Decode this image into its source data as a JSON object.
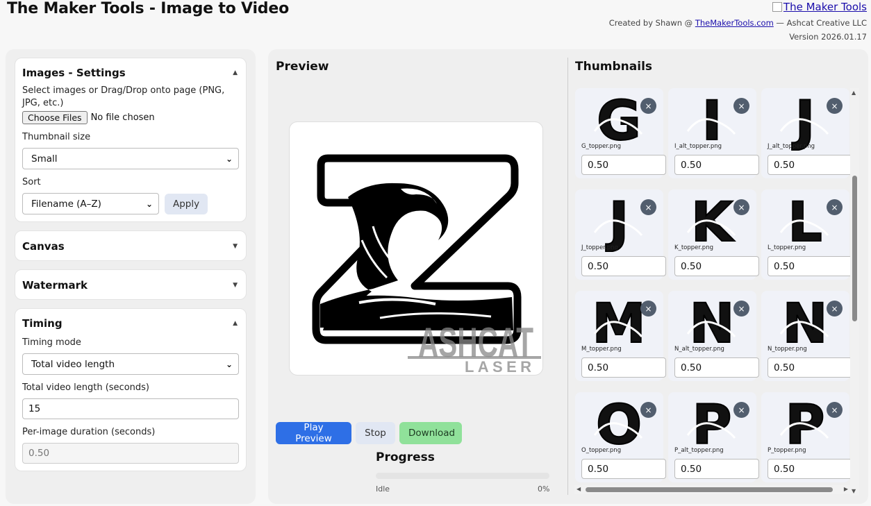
{
  "header": {
    "title": "The Maker Tools - Image to Video",
    "logo_alt": "The Maker Tools",
    "credit_prefix": "Created by Shawn @ ",
    "credit_link": "TheMakerTools.com",
    "credit_suffix": " — Ashcat Creative LLC",
    "version": "Version 2026.01.17"
  },
  "images_settings": {
    "title": "Images - Settings",
    "select_hint": "Select images or Drag/Drop onto page (PNG, JPG, etc.)",
    "choose_files": "Choose Files",
    "no_file": "No file chosen",
    "thumb_size_label": "Thumbnail size",
    "thumb_size_value": "Small",
    "sort_label": "Sort",
    "sort_value": "Filename (A–Z)",
    "apply": "Apply"
  },
  "canvas": {
    "title": "Canvas"
  },
  "watermark": {
    "title": "Watermark"
  },
  "timing": {
    "title": "Timing",
    "mode_label": "Timing mode",
    "mode_value": "Total video length",
    "total_label": "Total video length (seconds)",
    "total_value": "15",
    "per_label": "Per-image duration (seconds)",
    "per_value": "0.50"
  },
  "preview": {
    "title": "Preview",
    "watermark_line1": "ASHCAT",
    "watermark_line2": "LASER",
    "play": "Play Preview",
    "stop": "Stop",
    "download": "Download"
  },
  "progress": {
    "title": "Progress",
    "status": "Idle",
    "percent": "0%",
    "value": 0
  },
  "thumbnails": {
    "title": "Thumbnails",
    "items": [
      {
        "letter": "G",
        "name": "G_topper.png",
        "duration": "0.50"
      },
      {
        "letter": "I",
        "name": "I_alt_topper.png",
        "duration": "0.50"
      },
      {
        "letter": "J",
        "name": "J_alt_topper.png",
        "duration": "0.50"
      },
      {
        "letter": "J",
        "name": "J_topper.png",
        "duration": "0.50"
      },
      {
        "letter": "K",
        "name": "K_topper.png",
        "duration": "0.50"
      },
      {
        "letter": "L",
        "name": "L_topper.png",
        "duration": "0.50"
      },
      {
        "letter": "M",
        "name": "M_topper.png",
        "duration": "0.50"
      },
      {
        "letter": "N",
        "name": "N_alt_topper.png",
        "duration": "0.50"
      },
      {
        "letter": "N",
        "name": "N_topper.png",
        "duration": "0.50"
      },
      {
        "letter": "O",
        "name": "O_topper.png",
        "duration": "0.50"
      },
      {
        "letter": "P",
        "name": "P_alt_topper.png",
        "duration": "0.50"
      },
      {
        "letter": "P",
        "name": "P_topper.png",
        "duration": "0.50"
      }
    ]
  },
  "icons": {
    "collapse": "triangle-up-icon",
    "expand": "triangle-down-icon",
    "close": "close-icon",
    "select_chevron": "chevron-down-icon"
  },
  "colors": {
    "primary": "#2e6fe6",
    "success": "#90e19a",
    "secondary": "#e1e7f3",
    "close_badge": "#525e6e"
  }
}
